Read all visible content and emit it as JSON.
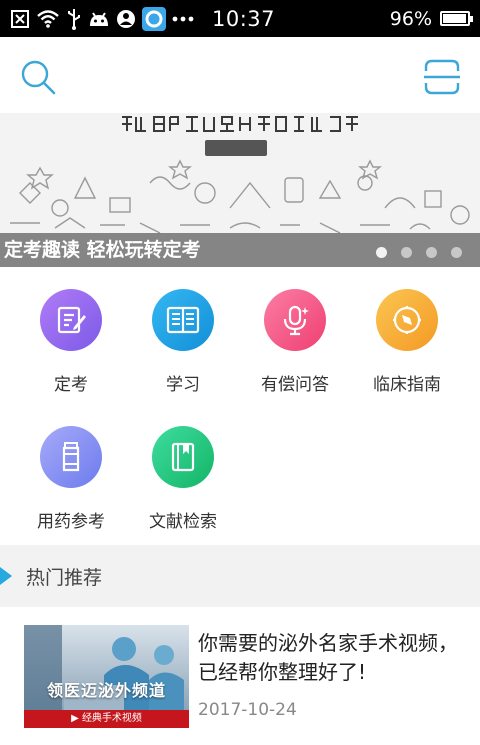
{
  "status_bar": {
    "time": "10:37",
    "battery_percent": "96%",
    "battery_level": 0.96,
    "left_icons": [
      "close-box-icon",
      "wifi-icon",
      "usb-icon",
      "android-icon",
      "person-icon",
      "app-circle-icon",
      "more-dots-icon"
    ]
  },
  "top_bar": {
    "left_icon": "search-icon",
    "right_icon": "scan-icon"
  },
  "banner": {
    "caption": "定考趣读 轻松玩转定考",
    "slide_count": 4,
    "active_slide": 1
  },
  "grid": {
    "items": [
      {
        "label": "定考",
        "icon": "edit-note-icon",
        "color": "#9b6cf0"
      },
      {
        "label": "学习",
        "icon": "book-icon",
        "color": "#25a8ea"
      },
      {
        "label": "有偿问答",
        "icon": "microphone-icon",
        "color": "#f45a88"
      },
      {
        "label": "临床指南",
        "icon": "compass-icon",
        "color": "#f7b23e"
      },
      {
        "label": "用药参考",
        "icon": "medicine-bottle-icon",
        "color": "#7f8ff3"
      },
      {
        "label": "文献检索",
        "icon": "bookmark-book-icon",
        "color": "#27c97f"
      }
    ]
  },
  "section": {
    "title": "热门推荐"
  },
  "article": {
    "title": "你需要的泌外名家手术视频，已经帮你整理好了!",
    "date": "2017-10-24",
    "thumb_text": "领医迈泌外频道",
    "thumb_bar_text": "经典手术视频"
  }
}
